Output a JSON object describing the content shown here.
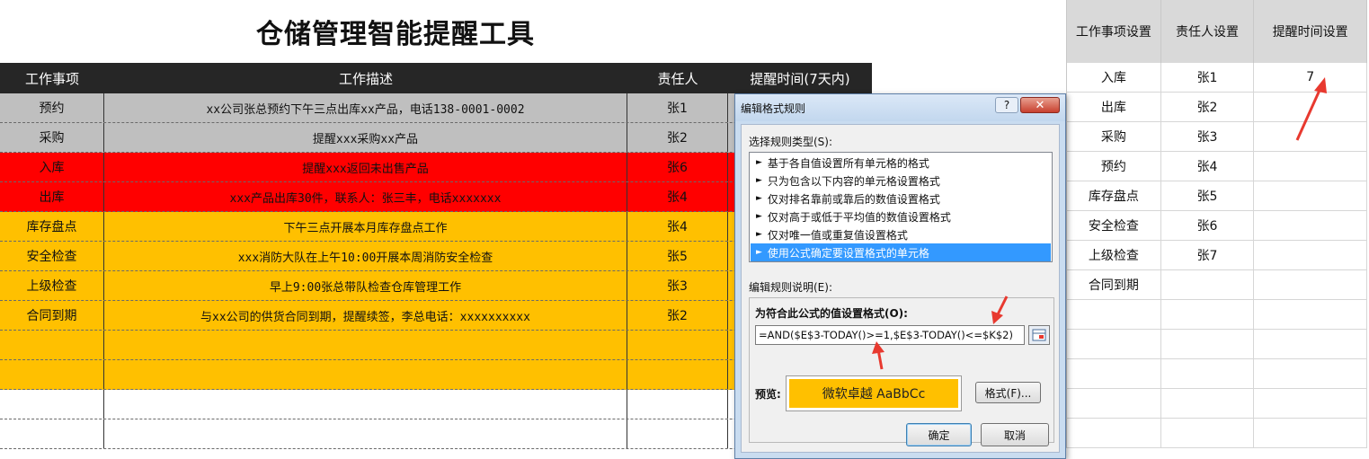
{
  "title": "仓储管理智能提醒工具",
  "main_table": {
    "headers": [
      "工作事项",
      "工作描述",
      "责任人",
      "提醒时间(7天内)"
    ],
    "rows": [
      {
        "item": "预约",
        "desc": "xx公司张总预约下午三点出库xx产品，电话138-0001-0002",
        "person": "张1",
        "color": "gray"
      },
      {
        "item": "采购",
        "desc": "提醒xxx采购xx产品",
        "person": "张2",
        "color": "gray"
      },
      {
        "item": "入库",
        "desc": "提醒xxx返回未出售产品",
        "person": "张6",
        "color": "red"
      },
      {
        "item": "出库",
        "desc": "xxx产品出库30件，联系人：张三丰，电话xxxxxxx",
        "person": "张4",
        "color": "red"
      },
      {
        "item": "库存盘点",
        "desc": "下午三点开展本月库存盘点工作",
        "person": "张4",
        "color": "orange"
      },
      {
        "item": "安全检查",
        "desc": "xxx消防大队在上午10:00开展本周消防安全检查",
        "person": "张5",
        "color": "orange"
      },
      {
        "item": "上级检查",
        "desc": "早上9:00张总带队检查仓库管理工作",
        "person": "张3",
        "color": "orange"
      },
      {
        "item": "合同到期",
        "desc": "与xx公司的供货合同到期，提醒续签，李总电话：xxxxxxxxxx",
        "person": "张2",
        "color": "orange"
      },
      {
        "item": "",
        "desc": "",
        "person": "",
        "color": "orange"
      },
      {
        "item": "",
        "desc": "",
        "person": "",
        "color": "orange"
      },
      {
        "item": "",
        "desc": "",
        "person": "",
        "color": "white"
      },
      {
        "item": "",
        "desc": "",
        "person": "",
        "color": "white"
      }
    ]
  },
  "settings_table": {
    "headers": [
      "工作事项设置",
      "责任人设置",
      "提醒时间设置"
    ],
    "rows": [
      {
        "item": "入库",
        "person": "张1",
        "days": "7"
      },
      {
        "item": "出库",
        "person": "张2",
        "days": ""
      },
      {
        "item": "采购",
        "person": "张3",
        "days": ""
      },
      {
        "item": "预约",
        "person": "张4",
        "days": ""
      },
      {
        "item": "库存盘点",
        "person": "张5",
        "days": ""
      },
      {
        "item": "安全检查",
        "person": "张6",
        "days": ""
      },
      {
        "item": "上级检查",
        "person": "张7",
        "days": ""
      },
      {
        "item": "合同到期",
        "person": "",
        "days": ""
      },
      {
        "item": "",
        "person": "",
        "days": ""
      },
      {
        "item": "",
        "person": "",
        "days": ""
      },
      {
        "item": "",
        "person": "",
        "days": ""
      },
      {
        "item": "",
        "person": "",
        "days": ""
      },
      {
        "item": "",
        "person": "",
        "days": ""
      }
    ]
  },
  "dialog": {
    "title": "编辑格式规则",
    "help_label": "?",
    "close_label": "✕",
    "rule_type_label": "选择规则类型(S):",
    "rule_types": [
      "基于各自值设置所有单元格的格式",
      "只为包含以下内容的单元格设置格式",
      "仅对排名靠前或靠后的数值设置格式",
      "仅对高于或低于平均值的数值设置格式",
      "仅对唯一值或重复值设置格式",
      "使用公式确定要设置格式的单元格"
    ],
    "selected_rule_index": 5,
    "rule_desc_label": "编辑规则说明(E):",
    "formula_label": "为符合此公式的值设置格式(O):",
    "formula_value": "=AND($E$3-TODAY()>=1,$E$3-TODAY()<=$K$2)",
    "preview_label": "预览:",
    "preview_text": "微软卓越  AaBbCc",
    "format_button": "格式(F)...",
    "ok_button": "确定",
    "cancel_button": "取消"
  },
  "colors": {
    "header_bg": "#262626",
    "gray": "#bfbfbf",
    "red": "#ff0000",
    "orange": "#ffc000",
    "arrow": "#e8392f",
    "selection": "#3399ff"
  }
}
